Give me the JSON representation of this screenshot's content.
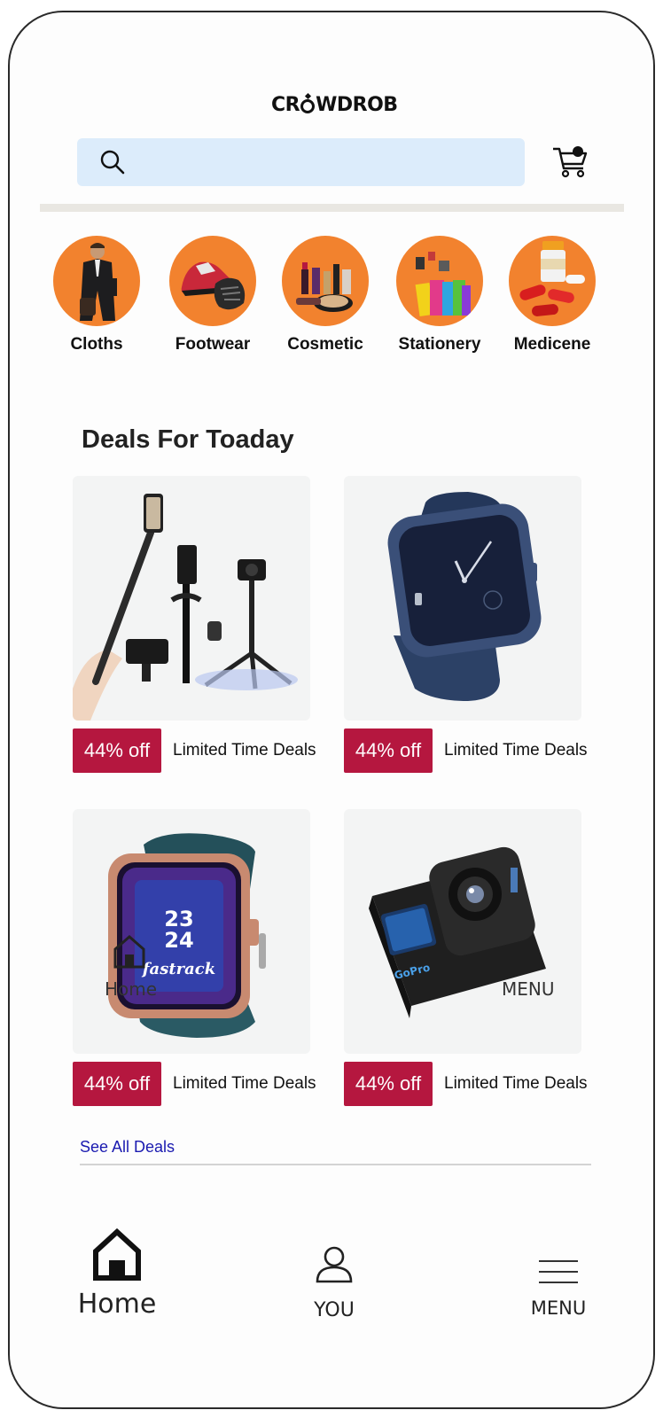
{
  "brand": {
    "name_parts": [
      "C",
      "R",
      "WDROB"
    ]
  },
  "search": {
    "placeholder": ""
  },
  "cart": {
    "badge": ""
  },
  "categories": [
    {
      "label": "Cloths"
    },
    {
      "label": "Footwear"
    },
    {
      "label": "Cosmetic"
    },
    {
      "label": "Stationery"
    },
    {
      "label": "Medicene"
    }
  ],
  "deals": {
    "title": "Deals For Toaday",
    "items": [
      {
        "discount": "44% off",
        "text": "Limited Time Deals",
        "image": "selfie-stick-tripod"
      },
      {
        "discount": "44% off",
        "text": "Limited Time Deals",
        "image": "smartwatch-blue"
      },
      {
        "discount": "44% off",
        "text": "Limited Time Deals",
        "image": "fastrack-smartwatch"
      },
      {
        "discount": "44% off",
        "text": "Limited Time Deals",
        "image": "gopro-action-camera"
      }
    ],
    "see_all": "See All Deals"
  },
  "watch_face": {
    "line1": "23",
    "line2": "24",
    "brand": "fastrack"
  },
  "camera": {
    "brand": "GoPro"
  },
  "ghost_overlay": {
    "home": "Home",
    "menu": "MENU"
  },
  "bottom_nav": {
    "home": "Home",
    "you": "YOU",
    "menu": "MENU"
  },
  "colors": {
    "accent_orange": "#f2822e",
    "deal_red": "#b5173f",
    "search_bg": "#dcecfb",
    "link_blue": "#1a1ab0"
  }
}
